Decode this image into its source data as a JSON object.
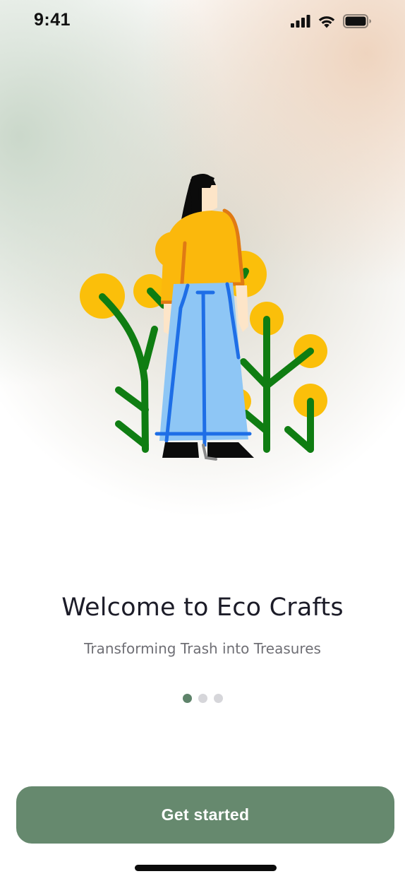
{
  "status_bar": {
    "time": "9:41",
    "icons": [
      "cellular-signal-icon",
      "wifi-icon",
      "battery-icon"
    ]
  },
  "onboarding": {
    "illustration": "woman-with-plants-illustration",
    "title": "Welcome to Eco Crafts",
    "subtitle": "Transforming Trash into Treasures",
    "pagination": {
      "total": 3,
      "active_index": 0
    }
  },
  "actions": {
    "get_started_label": "Get started"
  },
  "colors": {
    "accent": "#66896e",
    "dot_active": "#5e836a",
    "dot_inactive": "#d6d6da",
    "title": "#1c1c28",
    "subtitle": "#6f6f75",
    "plant_green": "#0f7d12",
    "flower_yellow": "#fbbf0a",
    "sweater_orange": "#fbb80c",
    "skirt_blue": "#8ec6f5"
  }
}
